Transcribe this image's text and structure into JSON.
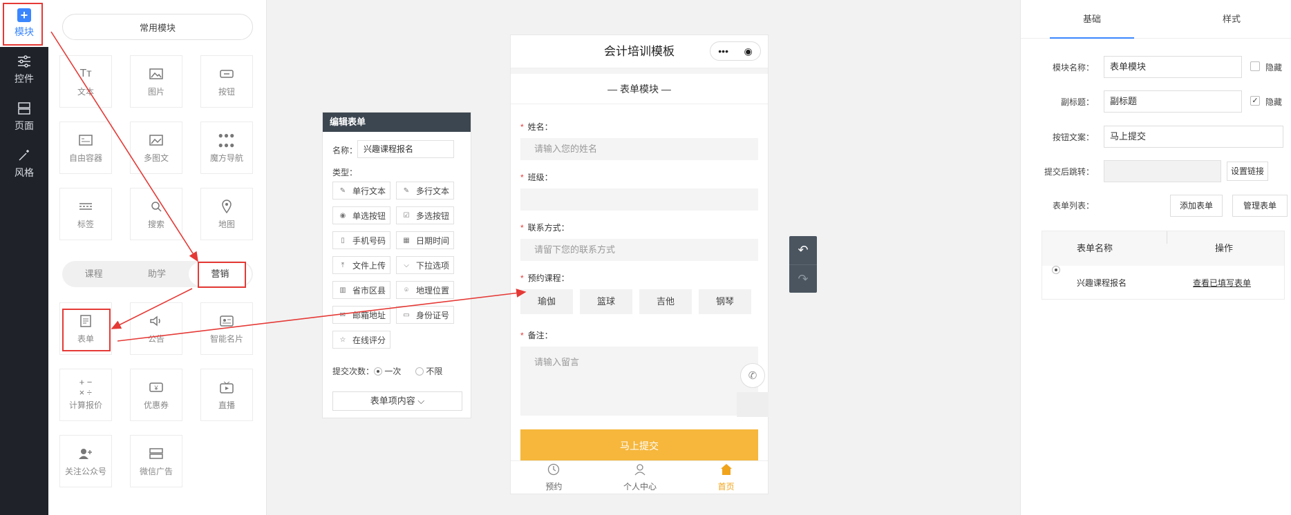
{
  "rail": {
    "items": [
      {
        "label": "模块",
        "icon": "plus-icon"
      },
      {
        "label": "控件",
        "icon": "sliders-icon"
      },
      {
        "label": "页面",
        "icon": "pages-icon"
      },
      {
        "label": "风格",
        "icon": "magic-wand-icon"
      }
    ]
  },
  "palette": {
    "common_label": "常用模块",
    "common_tiles": [
      "文本",
      "图片",
      "按钮",
      "自由容器",
      "多图文",
      "魔方导航",
      "标签",
      "搜索",
      "地图"
    ],
    "segments": [
      "课程",
      "助学",
      "营销"
    ],
    "marketing_tiles": [
      "表单",
      "公告",
      "智能名片",
      "计算报价",
      "优惠券",
      "直播",
      "关注公众号",
      "微信广告"
    ]
  },
  "edit_form": {
    "header": "编辑表单",
    "name_label": "名称：",
    "name_value": "兴趣课程报名",
    "type_label": "类型：",
    "types": [
      "单行文本",
      "多行文本",
      "单选按钮",
      "多选按钮",
      "手机号码",
      "日期时间",
      "文件上传",
      "下拉选项",
      "省市区县",
      "地理位置",
      "邮箱地址",
      "身份证号",
      "在线评分"
    ],
    "submit_count_label": "提交次数：",
    "submit_once": "一次",
    "submit_unlimited": "不限",
    "content_button": "表单项内容 ⌵"
  },
  "phone": {
    "title": "会计培训模板",
    "subtitle": "表单模块",
    "fields": [
      {
        "label": "姓名：",
        "placeholder": "请输入您的姓名"
      },
      {
        "label": "班级：",
        "placeholder": ""
      },
      {
        "label": "联系方式：",
        "placeholder": "请留下您的联系方式"
      }
    ],
    "course_label": "预约课程：",
    "course_options": [
      "瑜伽",
      "篮球",
      "吉他",
      "钢琴"
    ],
    "remark_label": "备注：",
    "remark_placeholder": "请输入留言",
    "submit_label": "马上提交",
    "tabbar": [
      "预约",
      "个人中心",
      "首页"
    ]
  },
  "settings": {
    "tabs": [
      "基础",
      "样式"
    ],
    "module_name_label": "模块名称：",
    "module_name_value": "表单模块",
    "hide_label": "隐藏",
    "subtitle_label": "副标题：",
    "subtitle_value": "副标题",
    "subtitle_hide_label": "隐藏",
    "button_text_label": "按钮文案：",
    "button_text_value": "马上提交",
    "redirect_label": "提交后跳转：",
    "redirect_button": "设置链接",
    "form_list_label": "表单列表：",
    "add_form_button": "添加表单",
    "manage_form_button": "管理表单",
    "table_headers": [
      "表单名称",
      "操作"
    ],
    "table_rows": [
      {
        "name": "兴趣课程报名",
        "action": "查看已填写表单"
      }
    ]
  },
  "colors": {
    "accent_blue": "#3a86ff",
    "submit_orange": "#f6b73c",
    "annotation_red": "#e53935",
    "rail_dark": "#1f2329"
  }
}
